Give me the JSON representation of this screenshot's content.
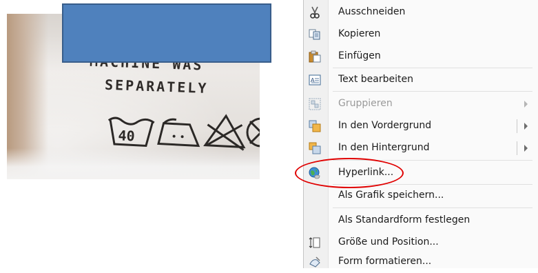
{
  "photo": {
    "label_lines": [
      "MACHINE WAS",
      "SEPARATELY"
    ],
    "wash_temperature": "40"
  },
  "context_menu": {
    "items": [
      {
        "label": "Ausschneiden",
        "icon": "scissors-icon",
        "enabled": true
      },
      {
        "label": "Kopieren",
        "icon": "copy-icon",
        "enabled": true
      },
      {
        "label": "Einfügen",
        "icon": "paste-icon",
        "enabled": true
      },
      {
        "label": "Text bearbeiten",
        "icon": "text-edit-icon",
        "enabled": true
      },
      {
        "label": "Gruppieren",
        "icon": "group-icon",
        "enabled": false,
        "submenu": true
      },
      {
        "label": "In den Vordergrund",
        "icon": "bring-to-front-icon",
        "enabled": true,
        "submenu": true
      },
      {
        "label": "In den Hintergrund",
        "icon": "send-to-back-icon",
        "enabled": true,
        "submenu": true
      },
      {
        "label": "Hyperlink...",
        "icon": "hyperlink-globe-icon",
        "enabled": true,
        "highlighted": true
      },
      {
        "label": "Als Grafik speichern...",
        "enabled": true
      },
      {
        "label": "Als Standardform festlegen",
        "enabled": true
      },
      {
        "label": "Größe und Position...",
        "icon": "size-position-icon",
        "enabled": true
      },
      {
        "label": "Form formatieren...",
        "icon": "format-shape-icon",
        "enabled": true
      }
    ]
  },
  "colors": {
    "shape_fill": "#4f81bd",
    "shape_border": "#385d8a",
    "highlight_oval": "#e00000"
  }
}
